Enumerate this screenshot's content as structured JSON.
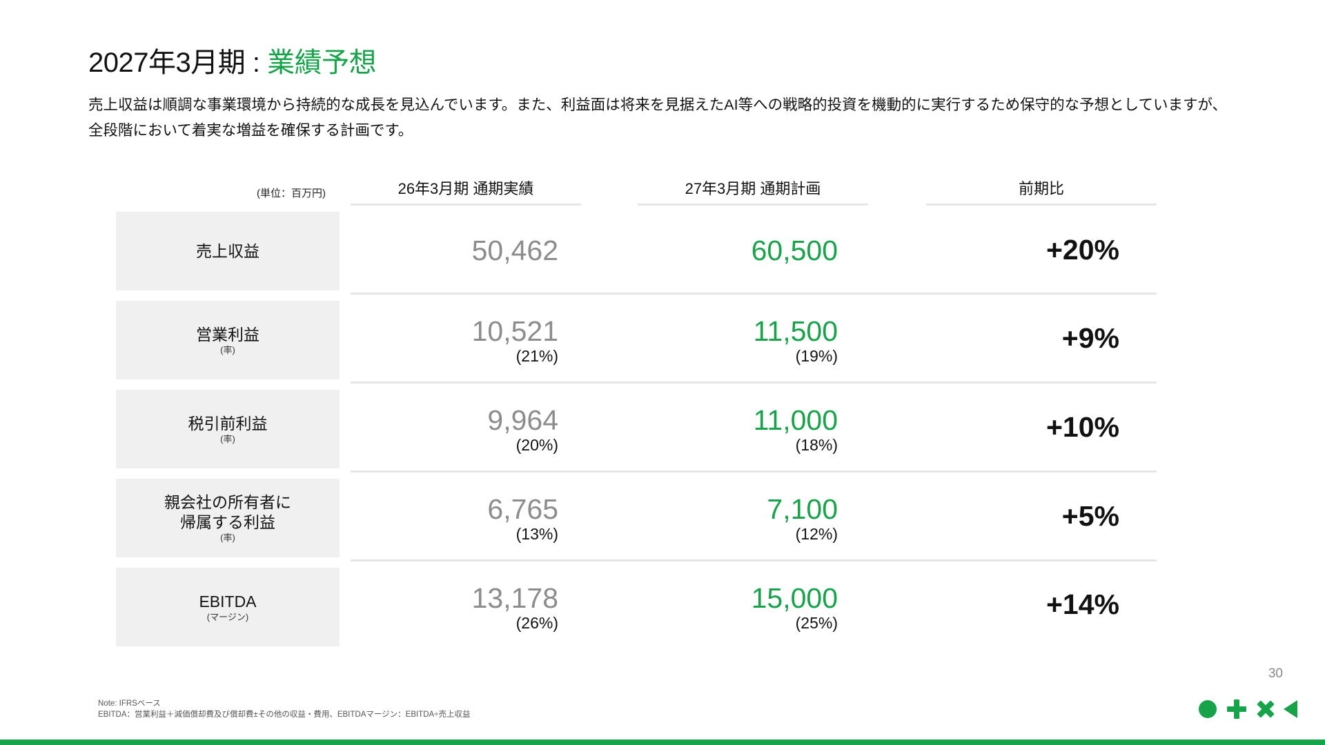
{
  "header": {
    "title_prefix": "2027年3月期 : ",
    "title_accent": "業績予想",
    "description": "売上収益は順調な事業環境から持続的な成長を見込んでいます。また、利益面は将来を見据えたAI等への戦略的投資を機動的に実行するため保守的な予想としていますが、全段階において着実な増益を確保する計画です。"
  },
  "table": {
    "unit": "(単位：百万円)",
    "columns": [
      "26年3月期 通期実績",
      "27年3月期 通期計画",
      "前期比"
    ],
    "rows": [
      {
        "label": "売上収益",
        "sub": "",
        "prev": "50,462",
        "prev_pct": "",
        "plan": "60,500",
        "plan_pct": "",
        "change": "+20%"
      },
      {
        "label": "営業利益",
        "sub": "(率)",
        "prev": "10,521",
        "prev_pct": "(21%)",
        "plan": "11,500",
        "plan_pct": "(19%)",
        "change": "+9%"
      },
      {
        "label": "税引前利益",
        "sub": "(率)",
        "prev": "9,964",
        "prev_pct": "(20%)",
        "plan": "11,000",
        "plan_pct": "(18%)",
        "change": "+10%"
      },
      {
        "label": "親会社の所有者に\n帰属する利益",
        "sub": "(率)",
        "prev": "6,765",
        "prev_pct": "(13%)",
        "plan": "7,100",
        "plan_pct": "(12%)",
        "change": "+5%"
      },
      {
        "label": "EBITDA",
        "sub": "(マージン)",
        "prev": "13,178",
        "prev_pct": "(26%)",
        "plan": "15,000",
        "plan_pct": "(25%)",
        "change": "+14%"
      }
    ]
  },
  "footer": {
    "page_number": "30",
    "note_line1": "Note: IFRSベース",
    "note_line2": "EBITDA：営業利益＋減価償却費及び償却費±その他の収益・費用、EBITDAマージン：EBITDA÷売上収益"
  },
  "colors": {
    "accent": "#16a34a",
    "prev_value": "#8c8c8c",
    "label_bg": "#f0f0f0"
  },
  "icons": [
    "circle-icon",
    "plus-icon",
    "cross-icon",
    "triangle-icon"
  ]
}
